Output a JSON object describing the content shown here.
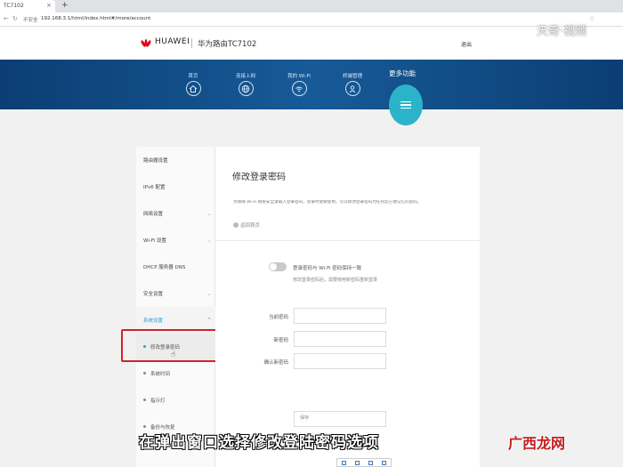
{
  "browser": {
    "tab_title": "TC7102",
    "new_tab": "+",
    "close": "×",
    "secure": "不安全",
    "url": "192.168.3.1/html/index.html#/more/account"
  },
  "header": {
    "brand": "HUAWEI",
    "model": "华为路由TC7102",
    "logout": "退出",
    "logo_color": "#e60012"
  },
  "nav": {
    "items": [
      {
        "label": "首页",
        "icon": "home-icon"
      },
      {
        "label": "连接上网",
        "icon": "globe-icon"
      },
      {
        "label": "我的 Wi-Fi",
        "icon": "wifi-icon"
      },
      {
        "label": "终端管理",
        "icon": "user-icon"
      }
    ],
    "more_label": "更多功能",
    "accent": "#2bb3c9"
  },
  "sidebar": {
    "items": [
      {
        "label": "路由器设置"
      },
      {
        "label": "IPv6 配置"
      },
      {
        "label": "网络设置"
      },
      {
        "label": "Wi-Fi 设置"
      },
      {
        "label": "DHCP 服务器 DNS"
      },
      {
        "label": "安全设置"
      },
      {
        "label": "系统设置"
      }
    ],
    "sub_items": [
      {
        "label": "修改登录密码"
      },
      {
        "label": "系统时间"
      },
      {
        "label": "指示灯"
      },
      {
        "label": "备份与恢复"
      }
    ]
  },
  "content": {
    "title": "修改登录密码",
    "description": "为保障 Wi-Fi 网络安全请输入登录密码，登录时需要使用，可以修改登录密码为任何您方便记忆的密码。",
    "back": "返回首页",
    "toggle_label": "登录密码与 Wi-Fi 密码保持一致",
    "toggle_hint": "修改登录密码后，需要使用新密码重新登录",
    "fields": [
      {
        "label": "当前密码",
        "value": ""
      },
      {
        "label": "新密码",
        "value": ""
      },
      {
        "label": "确认新密码",
        "value": ""
      }
    ],
    "save": "保存"
  },
  "overlay": {
    "watermark": "天奇·视频",
    "subtitle": "在弹出窗口选择修改登陆密码选项",
    "site": "广西龙网",
    "highlight_color": "#d0232a"
  }
}
